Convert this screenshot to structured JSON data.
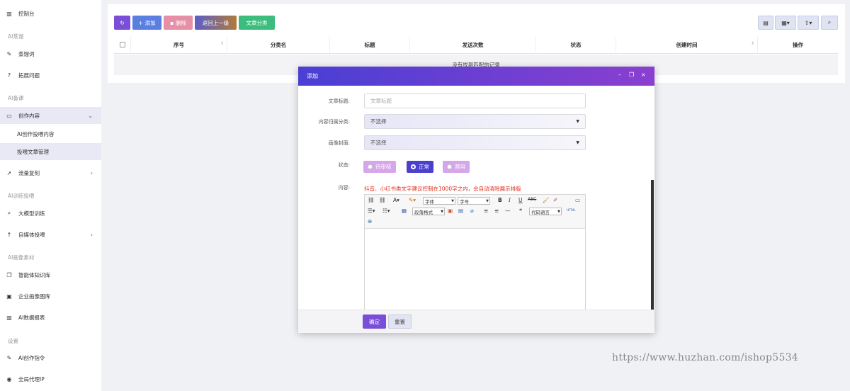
{
  "sidebar": {
    "dashboard": "控制台",
    "sec_ai_prompt": "AI蒸馏",
    "item_prompt_words": "蒸馏词",
    "item_expand_questions": "拓展问题",
    "sec_ai_material": "AI备课",
    "item_create_content": "创作内容",
    "sub_ai_create": "AI创作投喂内容",
    "sub_article_manage": "投喂文章管理",
    "item_traffic_copy": "流量复刻",
    "sec_ai_train": "AI训练投喂",
    "item_llm_train": "大模型训练",
    "item_self_media": "自媒体投喂",
    "sec_ai_assets": "AI画像素材",
    "item_knowledge": "智能体知识库",
    "item_company_images": "企业画像图库",
    "item_ai_report": "AI数据报表",
    "sec_settings": "设置",
    "item_ai_commands": "AI创作指令",
    "item_global_proxy": "全局代理IP"
  },
  "toolbar": {
    "add": "添加",
    "delete": "删除",
    "back": "返回上一级",
    "category": "文章分类"
  },
  "table": {
    "headers": [
      "序号",
      "分类名",
      "标题",
      "发送次数",
      "状态",
      "创建时间",
      "操作"
    ],
    "empty": "没有找到匹配的记录"
  },
  "dialog": {
    "title": "添加",
    "label_title": "文章标题:",
    "placeholder_title": "文章标题",
    "label_category": "内容归属分类:",
    "value_category": "不选择",
    "label_cover": "画像封面:",
    "value_cover": "不选择",
    "label_status": "状态:",
    "status_options": [
      "待审核",
      "正常",
      "禁用"
    ],
    "label_content": "内容:",
    "content_hint": "抖音、小红书类文字建议控制在1000字之内，会自动清除展示排版",
    "editor": {
      "font_family": "字体",
      "font_size": "字号",
      "paragraph": "段落格式",
      "code_lang": "代码语言",
      "html_btn": "HTML"
    },
    "confirm": "确定",
    "reset": "重置"
  },
  "watermark": "https://www.huzhan.com/ishop5534",
  "colors": {
    "accent": "#7a4fd8",
    "add_btn": "#5a7fe0",
    "delete_btn": "#e88fa8",
    "category_btn": "#3dbd7d",
    "dialog_head_start": "#4a3fd4",
    "dialog_head_end": "#8a3fd0"
  }
}
